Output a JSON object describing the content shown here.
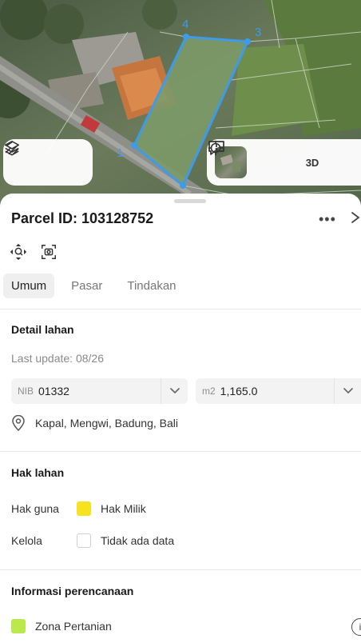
{
  "map": {
    "vertex_labels": [
      "4",
      "3",
      "1"
    ],
    "colors": {
      "parcel_outline": "#3d9bea"
    }
  },
  "map_controls": {
    "layers_icon": "layers-icon",
    "draw_icon": "draw-icon",
    "locate_icon": "crosshair-icon",
    "three_d_label": "3D",
    "feedback_icon": "feedback-icon"
  },
  "header": {
    "title": "Parcel ID: 103128752",
    "more_label": "•••"
  },
  "tabs": [
    {
      "label": "Umum",
      "active": true
    },
    {
      "label": "Pasar",
      "active": false
    },
    {
      "label": "Tindakan",
      "active": false
    }
  ],
  "detail": {
    "title": "Detail lahan",
    "last_update": "Last update: 08/26",
    "nib_prefix": "NIB",
    "nib_value": "01332",
    "area_prefix": "m2",
    "area_value": "1,165.0",
    "location": "Kapal, Mengwi, Badung, Bali"
  },
  "rights": {
    "title": "Hak lahan",
    "rows": [
      {
        "label": "Hak guna",
        "value": "Hak Milik",
        "color": "#f6e21f"
      },
      {
        "label": "Kelola",
        "value": "Tidak ada data",
        "color": "#ffffff"
      }
    ]
  },
  "planning": {
    "title": "Informasi perencanaan",
    "zone": "Zona Pertanian",
    "zone_color": "#b9e94a",
    "info_icon": "info-icon"
  }
}
